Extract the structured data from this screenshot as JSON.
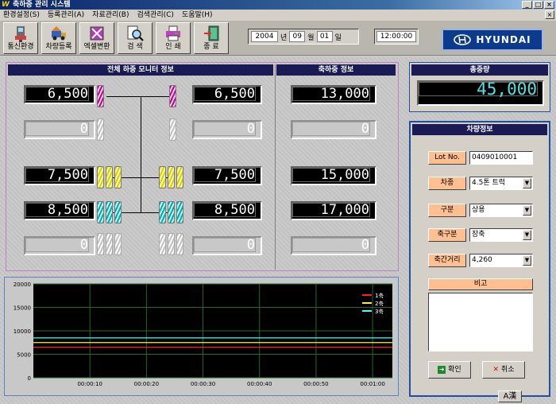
{
  "window": {
    "title": "축하중 관리 시스템",
    "app_icon_glyph": "W"
  },
  "menu": [
    "환경설정(S)",
    "등록관리(A)",
    "자료관리(B)",
    "검색관리(C)",
    "도움말(H)"
  ],
  "toolbar": [
    {
      "label": "통신환경",
      "icon": "network-device-icon"
    },
    {
      "label": "차량등록",
      "icon": "vehicle-register-icon"
    },
    {
      "label": "엑셀변환",
      "icon": "excel-convert-icon"
    },
    {
      "label": "검  색",
      "icon": "search-icon"
    },
    {
      "label": "인  쇄",
      "icon": "print-icon"
    },
    {
      "label": "종  료",
      "icon": "exit-icon"
    }
  ],
  "date": {
    "year": "2004",
    "year_unit": "년",
    "month": "09",
    "month_unit": "월",
    "day": "01",
    "day_unit": "일"
  },
  "time": "12:00:00",
  "brand": "HYUNDAI",
  "monitor": {
    "title": "전체 하중 모니터 정보",
    "axle_title": "축하중 정보",
    "left_values": [
      "6,500",
      "0",
      "7,500",
      "8,500",
      "0"
    ],
    "right_values": [
      "6,500",
      "0",
      "7,500",
      "8,500",
      "0"
    ],
    "axle_values": [
      "13,000",
      "0",
      "15,000",
      "17,000",
      "0"
    ]
  },
  "total": {
    "title": "총중량",
    "value": "45,000"
  },
  "vehicle": {
    "title": "차량정보",
    "fields": [
      {
        "label": "Lot No.",
        "value": "0409010001",
        "dropdown": false
      },
      {
        "label": "차종",
        "value": "4.5톤 트럭",
        "dropdown": true
      },
      {
        "label": "구분",
        "value": "상용",
        "dropdown": true
      },
      {
        "label": "축구분",
        "value": "장축",
        "dropdown": true
      },
      {
        "label": "축간거리",
        "value": "4,260",
        "dropdown": true
      }
    ],
    "memo_label": "비고",
    "confirm_label": "확인",
    "cancel_label": "취소"
  },
  "ime": "A漢",
  "chart_data": {
    "type": "line",
    "title": "",
    "xlabel": "",
    "ylabel": "",
    "ylim": [
      0,
      20000
    ],
    "yticks": [
      0,
      5000,
      10000,
      15000,
      20000
    ],
    "x_ticks": [
      "00:00:10",
      "00:00:20",
      "00:00:30",
      "00:00:40",
      "00:00:50",
      "00:01:00"
    ],
    "grid": true,
    "legend_position": "top-right",
    "colors": {
      "background": "#000000",
      "grid": "#1f6b2a"
    },
    "series": [
      {
        "name": "1축",
        "color": "#ff2020",
        "values": [
          6500,
          6500
        ]
      },
      {
        "name": "2축",
        "color": "#ffee40",
        "values": [
          7500,
          7500
        ]
      },
      {
        "name": "3축",
        "color": "#40ffff",
        "values": [
          8500,
          8500
        ]
      }
    ]
  }
}
